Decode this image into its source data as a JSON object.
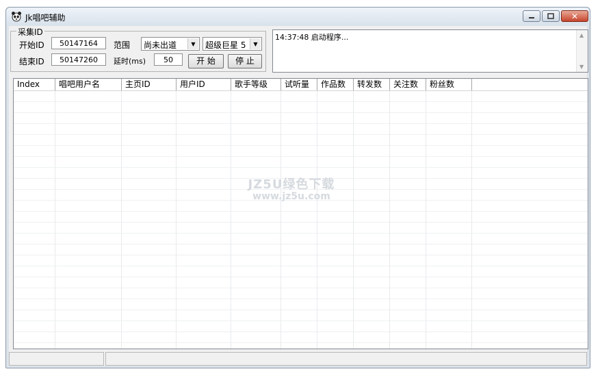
{
  "window": {
    "title": "Jk唱吧辅助",
    "close_glyph": "✕"
  },
  "collect": {
    "group_title": "采集ID",
    "start_label": "开始ID",
    "start_value": "50147164",
    "end_label": "结束ID",
    "end_value": "50147260",
    "range_label": "范围",
    "range_selected": "尚未出道",
    "level_selected": "超级巨星 5",
    "delay_label": "延时(ms)",
    "delay_value": "50",
    "start_button": "开 始",
    "stop_button": "停 止"
  },
  "log": {
    "entries": [
      "14:37:48  启动程序..."
    ]
  },
  "table": {
    "columns": [
      "Index",
      "唱吧用户名",
      "主页ID",
      "用户ID",
      "歌手等级",
      "试听量",
      "作品数",
      "转发数",
      "关注数",
      "粉丝数"
    ],
    "rows": []
  },
  "watermark": {
    "line1": "JZ5U绿色下载",
    "line2": "www.jz5u.com"
  },
  "status": {
    "pane1": "",
    "pane2": ""
  }
}
